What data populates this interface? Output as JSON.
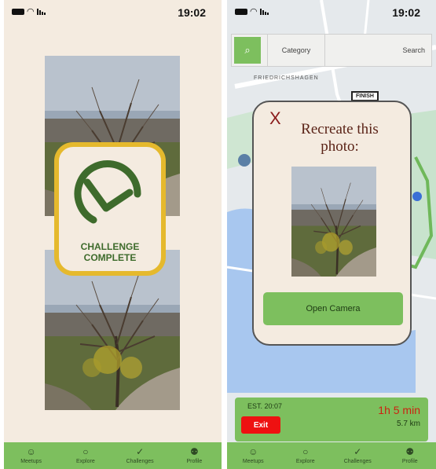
{
  "left_screen": {
    "status": {
      "time": "19:02"
    },
    "badge": {
      "line1": "CHALLENGE",
      "line2": "COMPLETE",
      "color": "#e5b92d",
      "check_color": "#3e6b2c"
    },
    "nav": [
      {
        "label": "Meetups",
        "icon": "people-icon"
      },
      {
        "label": "Explore",
        "icon": "compass-icon"
      },
      {
        "label": "Challenges",
        "icon": "check-icon"
      },
      {
        "label": "Profile",
        "icon": "person-icon"
      }
    ]
  },
  "right_screen": {
    "status": {
      "time": "19:02"
    },
    "search": {
      "placeholder": "Search",
      "category_label": "Category"
    },
    "map_labels": {
      "street": "FRIEDRICHSHAGEN",
      "finish": "FINISH"
    },
    "modal": {
      "close": "X",
      "title": "Recreate this photo:",
      "button": "Open Camera"
    },
    "trip": {
      "duration": "1h 5 min",
      "distance": "5.7 km",
      "est": "EST. 20:07",
      "exit": "Exit"
    },
    "nav": [
      {
        "label": "Meetups",
        "icon": "people-icon"
      },
      {
        "label": "Explore",
        "icon": "compass-icon"
      },
      {
        "label": "Challenges",
        "icon": "check-icon"
      },
      {
        "label": "Profile",
        "icon": "person-icon"
      }
    ]
  },
  "colors": {
    "accent": "#7dbf5e",
    "background": "#f4ebe0",
    "exit": "#ee1111",
    "gold": "#e5b92d"
  }
}
